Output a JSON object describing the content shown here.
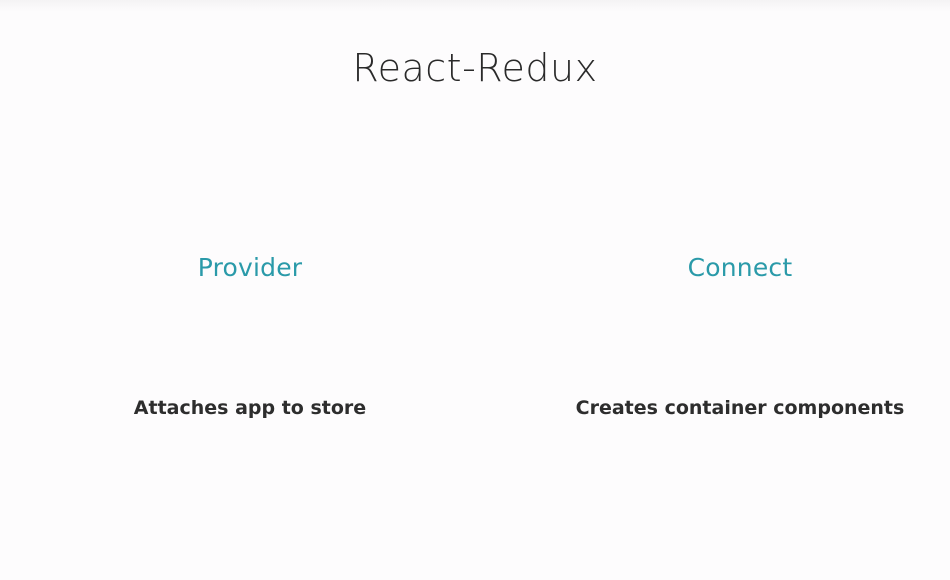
{
  "slide": {
    "title": "React-Redux",
    "columns": [
      {
        "heading": "Provider",
        "description": "Attaches app to store"
      },
      {
        "heading": "Connect",
        "description": "Creates container components"
      }
    ],
    "colors": {
      "background": "#fdfcfd",
      "heading": "#2a9aa9",
      "text": "#2d2d2d"
    }
  }
}
